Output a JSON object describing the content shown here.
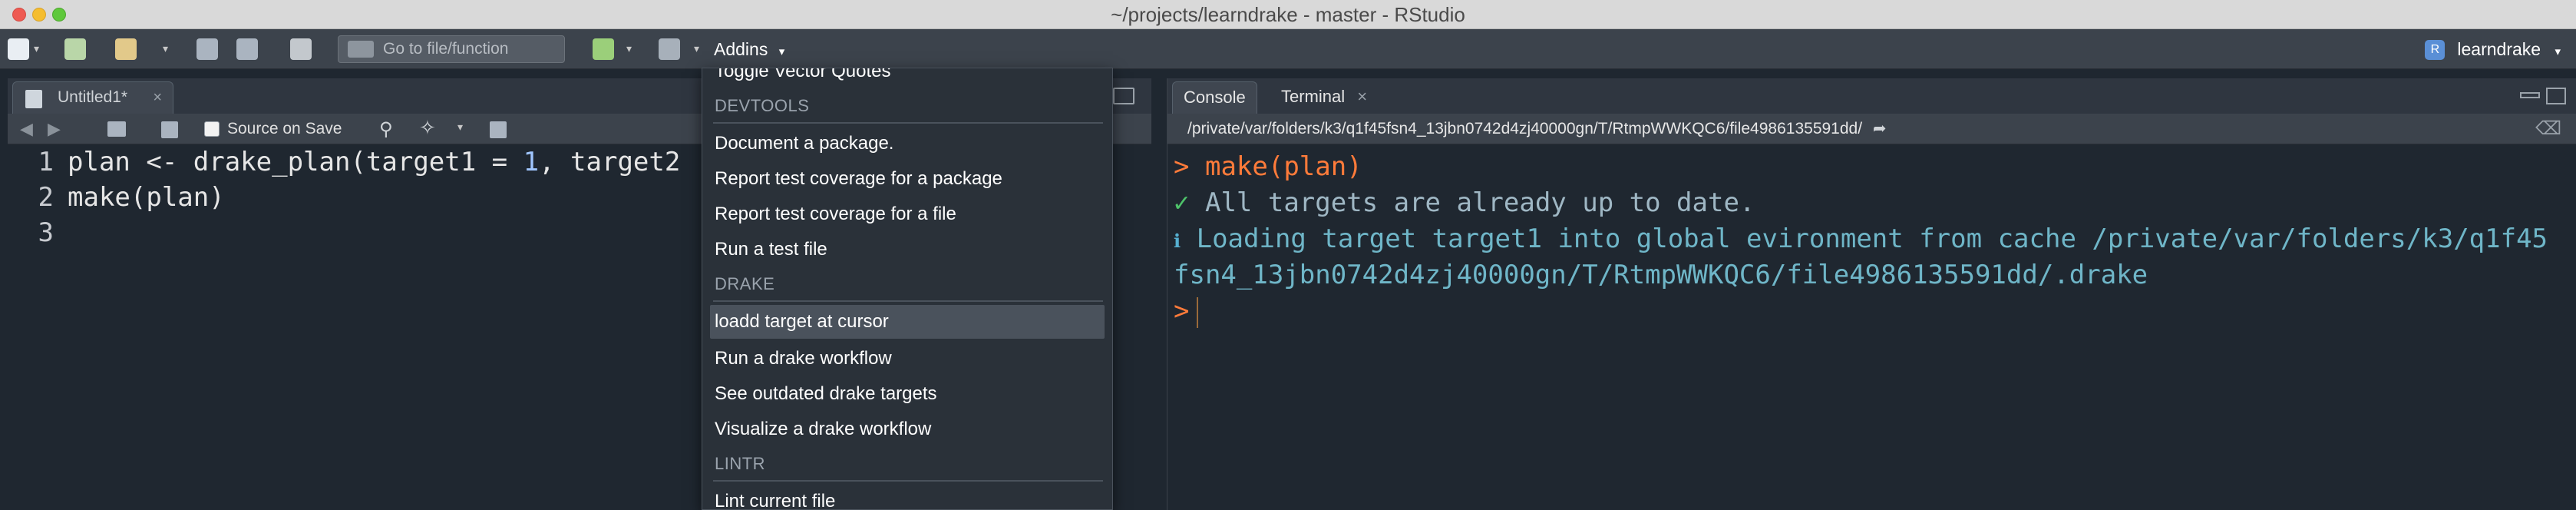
{
  "window": {
    "title": "~/projects/learndrake - master - RStudio"
  },
  "toolbar": {
    "goto_placeholder": "Go to file/function",
    "addins_label": "Addins",
    "project_label": "learndrake",
    "project_icon_letter": "R"
  },
  "editor": {
    "tab_label": "Untitled1*",
    "tab_close": "×",
    "source_on_save_label": "Source on Save",
    "lines": [
      {
        "number": "1",
        "parts": [
          "plan <- drake_plan(target1 = ",
          "1",
          ", target2"
        ]
      },
      {
        "number": "2",
        "text": "make(plan)"
      },
      {
        "number": "3",
        "text": ""
      }
    ]
  },
  "console_pane": {
    "tabs": [
      {
        "label": "Console",
        "active": true
      },
      {
        "label": "Terminal",
        "close": "×"
      }
    ],
    "path": "/private/var/folders/k3/q1f45fsn4_13jbn0742d4zj40000gn/T/RtmpWWKQC6/file4986135591dd/",
    "lines": {
      "cmd_prompt": ">",
      "cmd_text": "make(plan)",
      "ok_glyph": "✓",
      "ok_text": "All targets are already up to date.",
      "info_glyph": "ℹ",
      "info_text_1": "Loading target target1 into global evironment from cache /private/var/folders/k3/q1f45",
      "info_text_2": "fsn4_13jbn0742d4zj40000gn/T/RtmpWWKQC6/file4986135591dd/.drake",
      "empty_prompt": ">"
    }
  },
  "addins_menu": {
    "partial_top_item": "Toggle Vector Quotes",
    "sections": [
      {
        "title": "DEVTOOLS",
        "items": [
          "Document a package.",
          "Report test coverage for a package",
          "Report test coverage for a file",
          "Run a test file"
        ]
      },
      {
        "title": "DRAKE",
        "items": [
          "loadd target at cursor",
          "Run a drake workflow",
          "See outdated drake targets",
          "Visualize a drake workflow"
        ]
      },
      {
        "title": "LINTR",
        "items": [
          "Lint current file"
        ]
      }
    ],
    "highlighted_item": "loadd target at cursor"
  },
  "colors": {
    "accent_prompt": "#ff7b3a",
    "ok_green": "#4ec36a",
    "info_blue": "#56b0d1"
  }
}
